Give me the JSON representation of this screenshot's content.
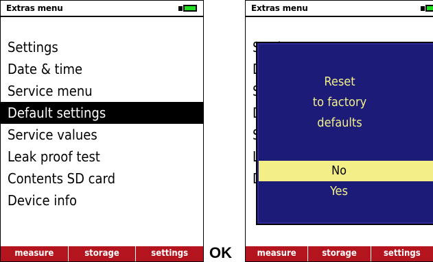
{
  "left_screen": {
    "title": "Extras menu",
    "menu_items": [
      "Settings",
      "Date & time",
      "Service menu",
      "Default settings",
      "Service values",
      "Leak proof test",
      "Contents SD card",
      "Device info"
    ],
    "selected_index": 3,
    "softkeys": [
      "measure",
      "storage",
      "settings"
    ]
  },
  "ok_label": "OK",
  "right_screen": {
    "title": "Extras menu",
    "background_menu_fragments": [
      "Setti",
      "D",
      "S",
      "D",
      "S",
      "L",
      "D"
    ],
    "dialog": {
      "message_lines": [
        "Reset",
        "to factory",
        "defaults"
      ],
      "options": [
        "No",
        "Yes"
      ],
      "selected_option_index": 0
    },
    "softkeys": [
      "measure",
      "storage",
      "settings"
    ]
  },
  "colors": {
    "battery_fill": "#22dd22",
    "softbar": "#b4141e",
    "dialog_bg": "#1c1c78",
    "dialog_text": "#f2f08a",
    "dialog_highlight": "#f4ee86"
  }
}
